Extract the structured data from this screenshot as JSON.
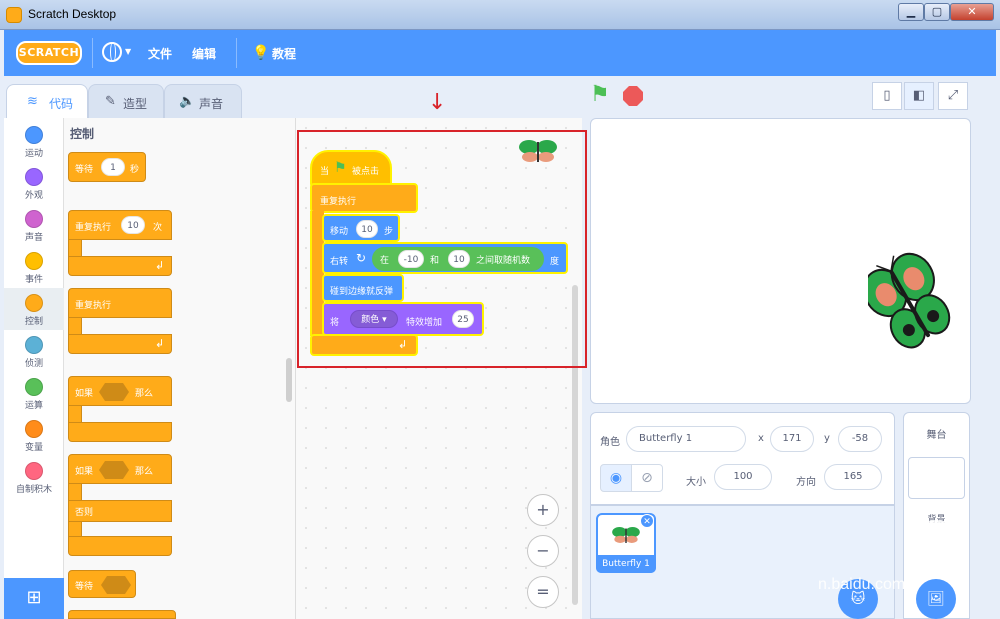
{
  "window": {
    "title": "Scratch Desktop",
    "min": "▁",
    "max": "▢",
    "close": "✕"
  },
  "menubar": {
    "logo": "SCRATCH",
    "file": "文件",
    "edit": "编辑",
    "tutorials": "教程"
  },
  "tabs": [
    {
      "label": "代码"
    },
    {
      "label": "造型"
    },
    {
      "label": "声音"
    }
  ],
  "categories": [
    {
      "label": "运动",
      "color": "#4c97ff"
    },
    {
      "label": "外观",
      "color": "#9966ff"
    },
    {
      "label": "声音",
      "color": "#cf63cf"
    },
    {
      "label": "事件",
      "color": "#ffbf00"
    },
    {
      "label": "控制",
      "color": "#ffab19"
    },
    {
      "label": "侦测",
      "color": "#5cb1d6"
    },
    {
      "label": "运算",
      "color": "#59c059"
    },
    {
      "label": "变量",
      "color": "#ff8c1a"
    },
    {
      "label": "自制积木",
      "color": "#ff6680"
    }
  ],
  "palette": {
    "heading": "控制",
    "wait": {
      "a": "等待",
      "v": "1",
      "b": "秒"
    },
    "repeat": {
      "a": "重复执行",
      "v": "10",
      "b": "次"
    },
    "forever": "重复执行",
    "if_then": {
      "a": "如果",
      "b": "那么"
    },
    "if_else": {
      "a": "如果",
      "b": "那么",
      "c": "否则"
    },
    "wait_until": "等待"
  },
  "script": {
    "hat": {
      "a": "当",
      "b": "被点击"
    },
    "forever": "重复执行",
    "move": {
      "a": "移动",
      "v": "10",
      "b": "步"
    },
    "turn": {
      "a": "右转",
      "b": "度"
    },
    "random": {
      "a": "在",
      "v1": "-10",
      "b": "和",
      "v2": "10",
      "c": "之间取随机数"
    },
    "bounce": "碰到边缘就反弹",
    "effect": {
      "a": "将",
      "menu": "颜色 ▾",
      "b": "特效增加",
      "v": "25"
    }
  },
  "zoom": {
    "in": "+",
    "out": "−",
    "reset": "="
  },
  "sprite_info": {
    "sprite_label": "角色",
    "name": "Butterfly 1",
    "x_label": "x",
    "x": "171",
    "y_label": "y",
    "y": "-58",
    "show_label": "显示",
    "size_label": "大小",
    "size": "100",
    "direction_label": "方向",
    "direction": "165"
  },
  "sprite_list": [
    {
      "name": "Butterfly 1"
    }
  ],
  "stage_pane": {
    "label": "舞台",
    "backdrops": "背景"
  },
  "watermark": "n.baidu.com",
  "colors": {
    "primary": "#4c97ff",
    "control": "#ffab19",
    "highlight": "#d8232a"
  }
}
